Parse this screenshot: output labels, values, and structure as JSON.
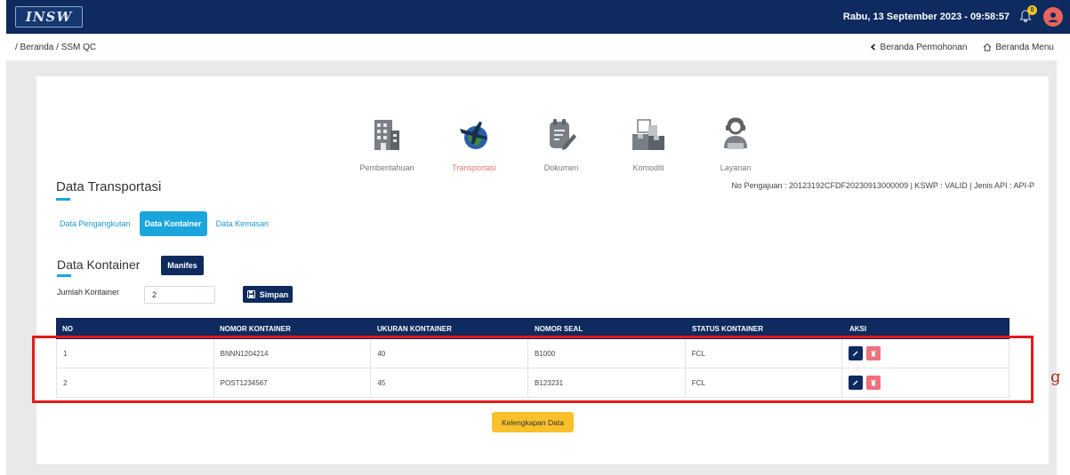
{
  "header": {
    "logo_text": "INSW",
    "datetime": "Rabu, 13 September 2023 - 09:58:57",
    "notification_count": "0"
  },
  "breadcrumb": {
    "path": "/ Beranda / SSM QC",
    "back_label": "Beranda Permohonan",
    "menu_label": "Beranda Menu"
  },
  "steps": [
    {
      "label": "Pemberitahuan",
      "icon": "building-icon",
      "active": false
    },
    {
      "label": "Transportasi",
      "icon": "plane-globe-icon",
      "active": true
    },
    {
      "label": "Dokumen",
      "icon": "document-icon",
      "active": false
    },
    {
      "label": "Komoditi",
      "icon": "boxes-icon",
      "active": false
    },
    {
      "label": "Layanan",
      "icon": "service-person-icon",
      "active": false
    }
  ],
  "section": {
    "title": "Data Transportasi",
    "info": "No Pengajuan : 20123192CFDF20230913000009 | KSWP : VALID | Jenis API : API-P"
  },
  "tabs": [
    {
      "label": "Data Pengangkutan",
      "active": false
    },
    {
      "label": "Data Kontainer",
      "active": true
    },
    {
      "label": "Data Kemasan",
      "active": false
    }
  ],
  "kontainer": {
    "title": "Data Kontainer",
    "manifes_label": "Manifes",
    "jumlah_label": "Jumlah Kontainer",
    "jumlah_value": "2",
    "simpan_label": "Simpan"
  },
  "table": {
    "headers": [
      "NO",
      "NOMOR KONTAINER",
      "UKURAN KONTAINER",
      "NOMOR SEAL",
      "STATUS KONTAINER",
      "AKSI"
    ],
    "rows": [
      [
        "1",
        "BNNN1204214",
        "40",
        "B1000",
        "FCL"
      ],
      [
        "2",
        "POST1234567",
        "45",
        "B123231",
        "FCL"
      ]
    ]
  },
  "kelengkapan_label": "Kelengkapan Data",
  "annotation_letter": "g",
  "colors": {
    "navy": "#0e2a5e",
    "accent": "#1aa6dc",
    "active_step": "#e9766a",
    "yellow": "#f8c12b",
    "highlight": "#e21a1a"
  }
}
